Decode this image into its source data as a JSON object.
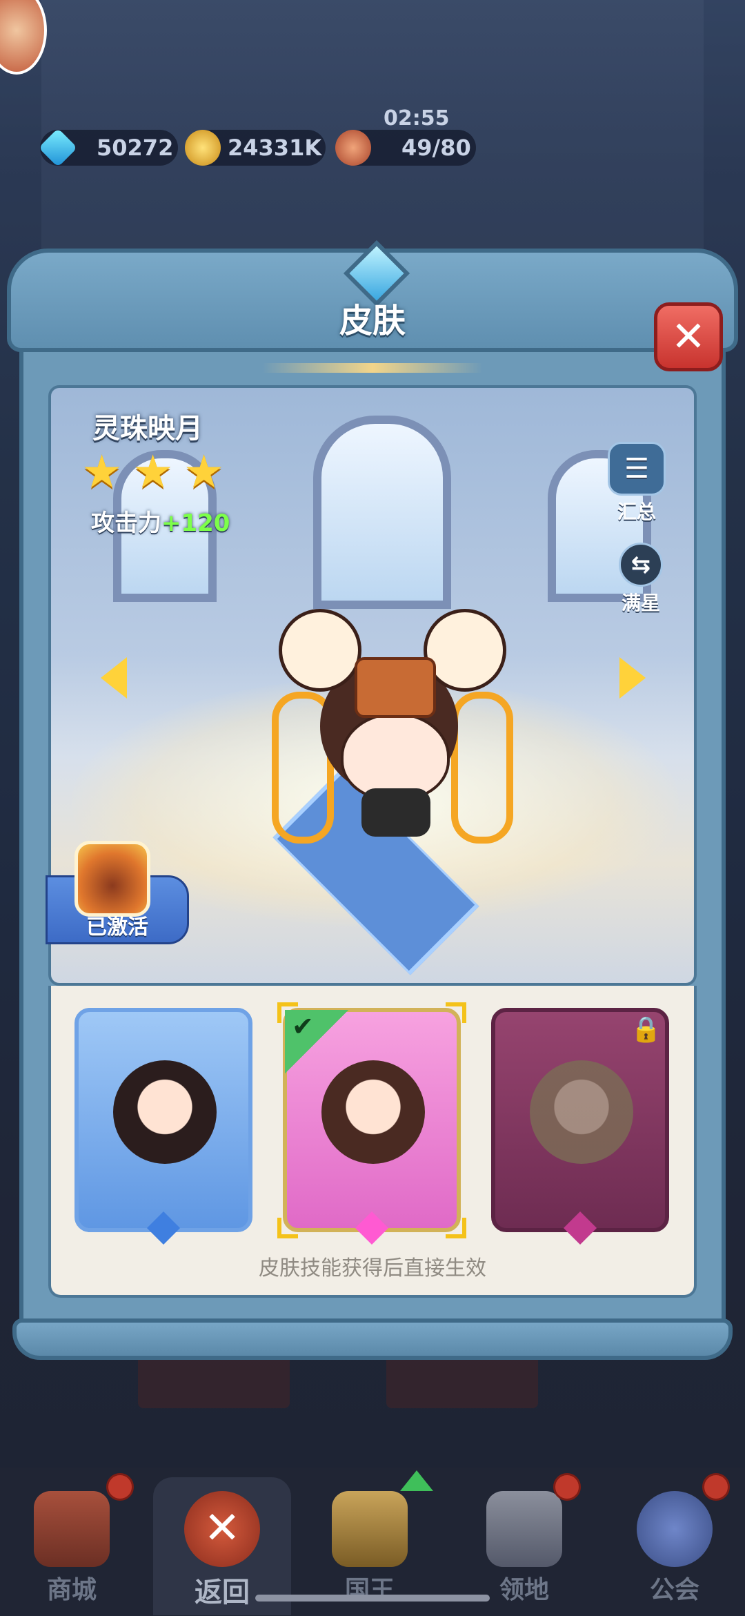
{
  "top_bar": {
    "gems": "50272",
    "gold": "24331K",
    "timer": "02:55",
    "stamina": "49/80"
  },
  "panel": {
    "title": "皮肤",
    "close_icon": "close-icon"
  },
  "skin_detail": {
    "name": "灵珠映月",
    "stars": 3,
    "attack_label": "攻击力",
    "attack_bonus": "+120",
    "summary_label": "汇总",
    "max_star_label": "满星",
    "activated_label": "已激活"
  },
  "skins": {
    "hint": "皮肤技能获得后直接生效",
    "cards": [
      {
        "state": "owned",
        "color": "#6fa2e6"
      },
      {
        "state": "selected",
        "color": "#e06ac7"
      },
      {
        "state": "locked",
        "color": "#6e2c52"
      }
    ]
  },
  "nav": {
    "items": [
      {
        "label": "商城",
        "badge": true
      },
      {
        "label": "返回",
        "badge": false
      },
      {
        "label": "国王",
        "badge": false,
        "upgrade": true
      },
      {
        "label": "领地",
        "badge": true
      },
      {
        "label": "公会",
        "badge": true
      }
    ]
  },
  "colors": {
    "accent_green": "#7dff4a",
    "star": "#ffd23a",
    "close_red": "#c8332e"
  }
}
